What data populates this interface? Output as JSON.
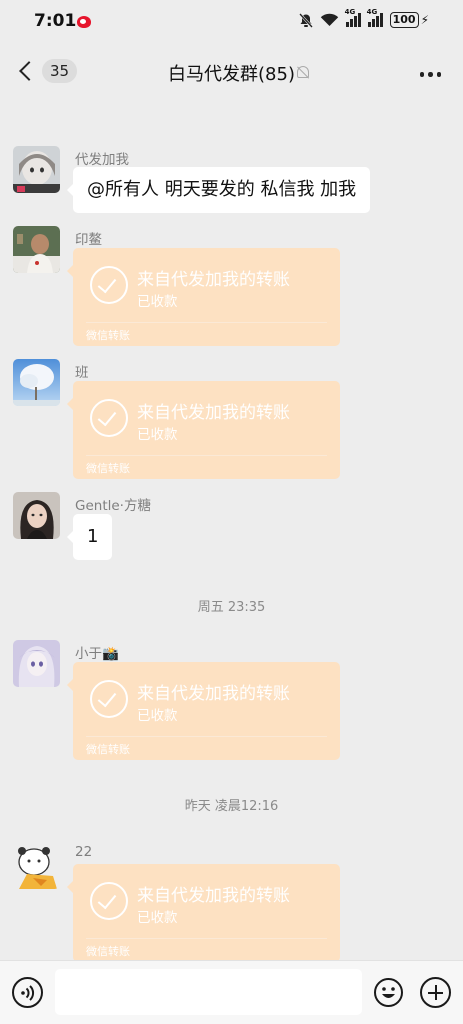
{
  "status_bar": {
    "time": "7:01",
    "signal_1": "4G",
    "signal_2": "4G",
    "battery": "100"
  },
  "header": {
    "unread_count": "35",
    "title": "白马代发群(85)",
    "icons": [
      "back-chevron-icon",
      "mute-bell-icon",
      "more-icon"
    ]
  },
  "messages": [
    {
      "sender": "代发加我",
      "type": "text",
      "text": "@所有人  明天要发的 私信我 加我"
    },
    {
      "sender": "印鳌",
      "type": "transfer",
      "title": "来自代发加我的转账",
      "status": "已收款",
      "footer": "微信转账"
    },
    {
      "sender": "班",
      "type": "transfer",
      "title": "来自代发加我的转账",
      "status": "已收款",
      "footer": "微信转账"
    },
    {
      "sender": "Gentle·方糖",
      "type": "text",
      "text": "1"
    },
    {
      "sender": "小于📸",
      "type": "transfer",
      "title": "来自代发加我的转账",
      "status": "已收款",
      "footer": "微信转账"
    },
    {
      "sender": "22",
      "type": "transfer",
      "title": "来自代发加我的转账",
      "status": "已收款",
      "footer": "微信转账"
    }
  ],
  "timestamps": [
    "周五 23:35",
    "昨天 凌晨12:16"
  ],
  "input_bar": {
    "placeholder": "",
    "icons": [
      "voice-icon",
      "emoji-icon",
      "plus-icon"
    ]
  },
  "colors": {
    "background": "#ededed",
    "transfer_bubble": "#fde1c2",
    "text_bubble": "#ffffff"
  }
}
